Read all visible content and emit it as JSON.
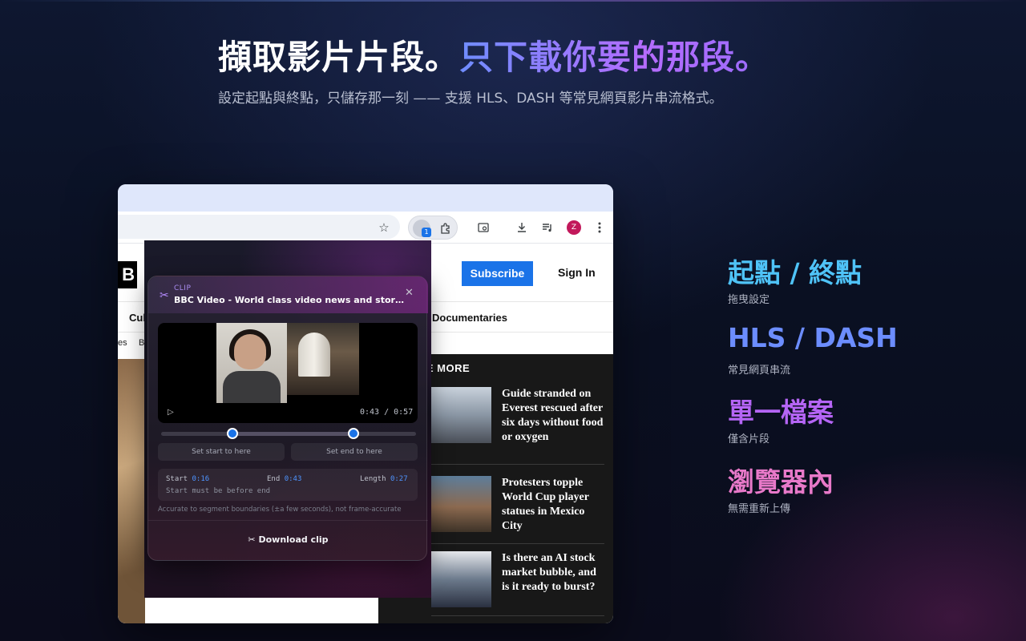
{
  "headline": {
    "part1": "擷取影片片段。",
    "part2": "只下載你要的那段。",
    "subtitle": "設定起點與終點，只儲存那一刻 —— 支援 HLS、DASH 等常見網頁影片串流格式。"
  },
  "browser": {
    "toolbar": {
      "star_icon": "☆",
      "extension_badge": "1",
      "avatar_letter": "Z"
    },
    "site": {
      "logo": "B",
      "subscribe_label": "Subscribe",
      "signin_label": "Sign In",
      "nav_culture": "Cul",
      "nav_documentaries": "Documentaries",
      "nav_es": "es",
      "nav_b": "B",
      "more_label": "RE MORE",
      "stories": [
        {
          "title": "Guide stranded on Everest rescued after six days without food or oxygen"
        },
        {
          "title": "Protesters topple World Cup player statues in Mexico City"
        },
        {
          "title": "Is there an AI stock market bubble, and is it ready to burst?"
        }
      ]
    }
  },
  "clip": {
    "label": "CLIP",
    "title": "BBC Video - World class video news and storytelling",
    "time_display": "0:43 / 0:57",
    "start_fraction": 0.281,
    "end_fraction": 0.754,
    "set_start_label": "Set start to here",
    "set_end_label": "Set end to here",
    "start_label": "Start",
    "start_value": "0:16",
    "end_label": "End",
    "end_value": "0:43",
    "length_label": "Length",
    "length_value": "0:27",
    "error": "Start must be before end",
    "accuracy_note": "Accurate to segment boundaries (±a few seconds), not frame-accurate",
    "download_label": "Download clip",
    "accent_color": "#1a73e8"
  },
  "features": [
    {
      "title": "起點 / 終點",
      "desc": "拖曳設定",
      "color": "#4fc3f7"
    },
    {
      "title": "HLS / DASH",
      "desc": "常見網頁串流",
      "color": "#6c8dff"
    },
    {
      "title": "單一檔案",
      "desc": "僅含片段",
      "color": "#b565f5"
    },
    {
      "title": "瀏覽器內",
      "desc": "無需重新上傳",
      "color": "#e879c9"
    }
  ]
}
